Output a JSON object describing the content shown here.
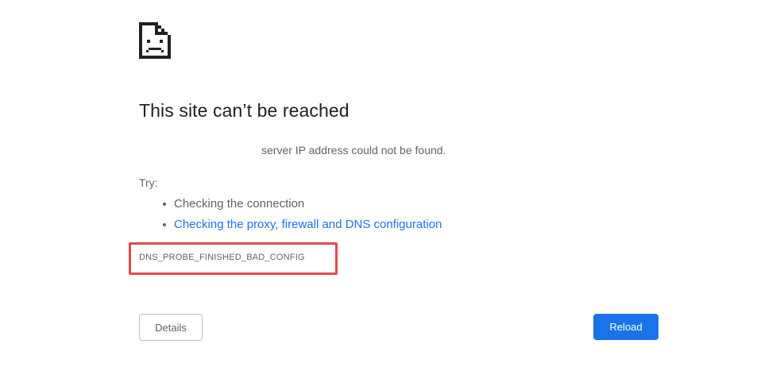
{
  "icon": "sad-page-icon",
  "main": {
    "title": "This site can’t be reached",
    "subtitle": "server IP address could not be found.",
    "try_label": "Try:",
    "suggestions": [
      "Checking the connection",
      "Checking the proxy, firewall and DNS configuration"
    ],
    "error_code": "DNS_PROBE_FINISHED_BAD_CONFIG"
  },
  "buttons": {
    "details_label": "Details",
    "reload_label": "Reload"
  },
  "colors": {
    "link": "#1a73e8",
    "primary_button": "#1a73e8",
    "highlight_box": "#e04b4b",
    "text_primary": "#202124",
    "text_secondary": "#5f6368"
  }
}
